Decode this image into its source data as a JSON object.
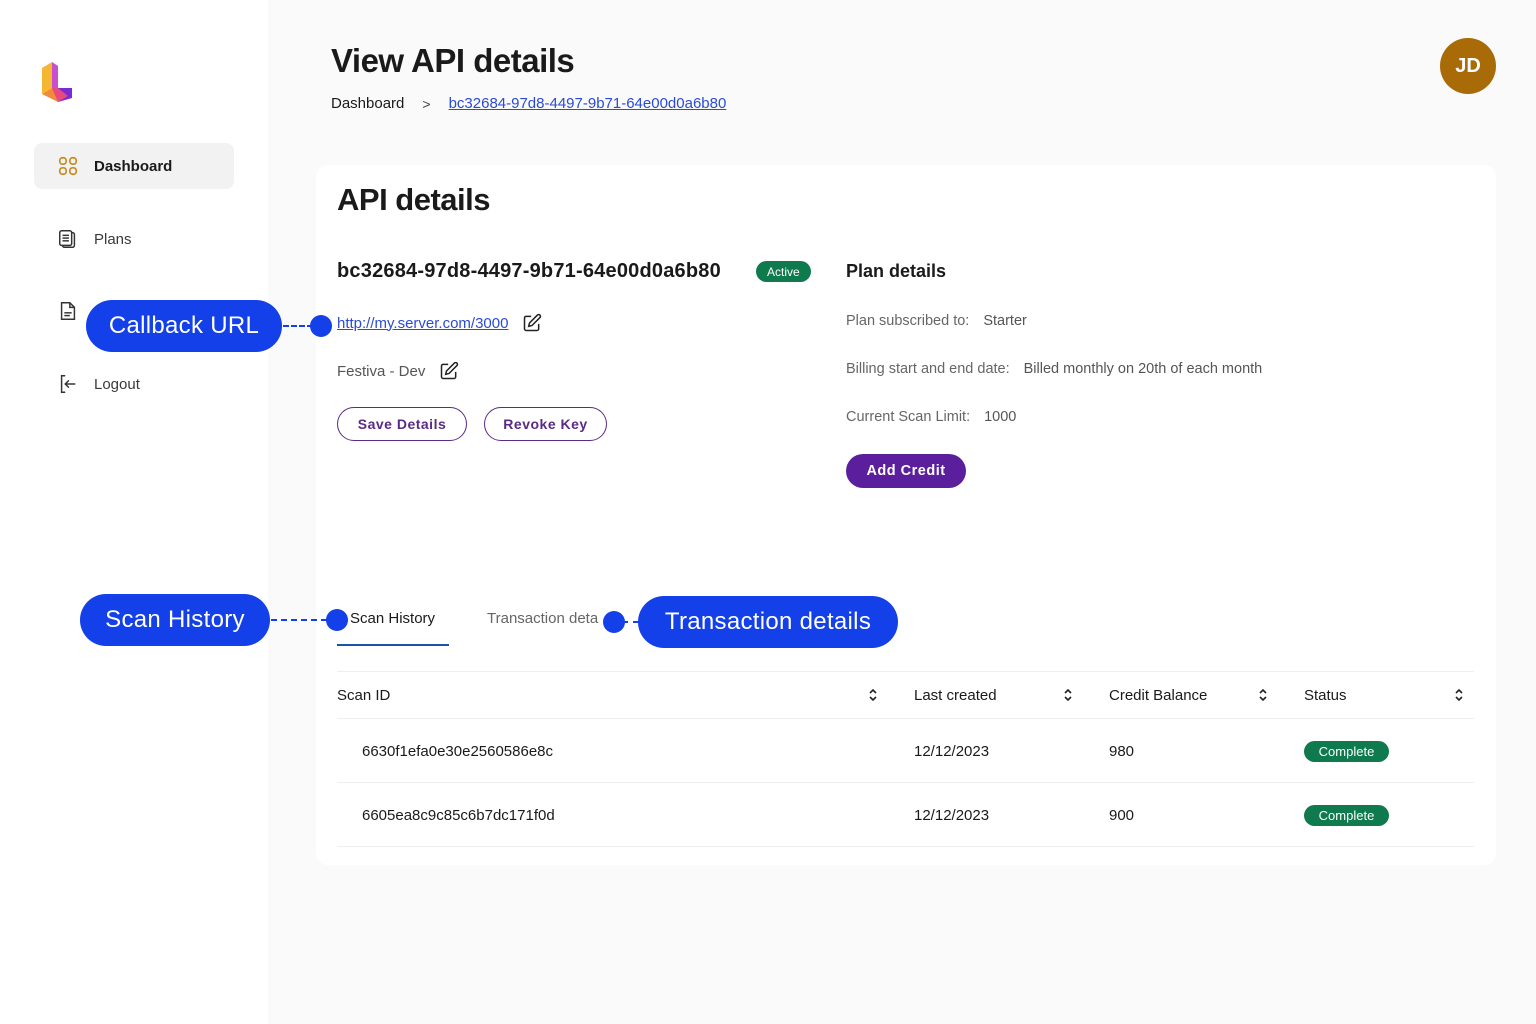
{
  "app": {
    "avatar_initials": "JD",
    "brand_color": "#5b1f9e",
    "accent_blue": "#1340e8"
  },
  "sidebar": {
    "items": [
      {
        "label": "Dashboard",
        "icon": "grid-icon",
        "active": true
      },
      {
        "label": "Plans",
        "icon": "clipboard-icon",
        "active": false
      },
      {
        "label": "",
        "icon": "document-icon",
        "active": false
      },
      {
        "label": "Logout",
        "icon": "logout-icon",
        "active": false
      }
    ]
  },
  "header": {
    "title": "View API details",
    "breadcrumb": {
      "home": "Dashboard",
      "separator": ">",
      "current": "bc32684-97d8-4497-9b71-64e00d0a6b80"
    }
  },
  "card": {
    "title": "API details",
    "key_id": "bc32684-97d8-4497-9b71-64e00d0a6b80",
    "status": "Active",
    "callback_url": "http://my.server.com/3000",
    "app_name": "Festiva - Dev",
    "buttons": {
      "save": "Save Details",
      "revoke": "Revoke Key"
    },
    "plan": {
      "title": "Plan details",
      "rows": [
        {
          "label": "Plan subscribed to:",
          "value": "Starter"
        },
        {
          "label": "Billing start and end date:",
          "value": "Billed monthly on 20th of each month"
        },
        {
          "label": "Current Scan Limit:",
          "value": "1000"
        }
      ],
      "add_credit": "Add Credit"
    }
  },
  "tabs": {
    "scan_history": "Scan History",
    "transaction": "Transaction deta"
  },
  "table": {
    "columns": [
      "Scan ID",
      "Last created",
      "Credit Balance",
      "Status"
    ],
    "rows": [
      {
        "scan_id": "6630f1efa0e30e2560586e8c",
        "last_created": "12/12/2023",
        "credit_balance": "980",
        "status": "Complete"
      },
      {
        "scan_id": "6605ea8c9c85c6b7dc171f0d",
        "last_created": "12/12/2023",
        "credit_balance": "900",
        "status": "Complete"
      }
    ]
  },
  "callouts": {
    "callback_url": "Callback URL",
    "scan_history": "Scan History",
    "transaction_details": "Transaction details"
  }
}
